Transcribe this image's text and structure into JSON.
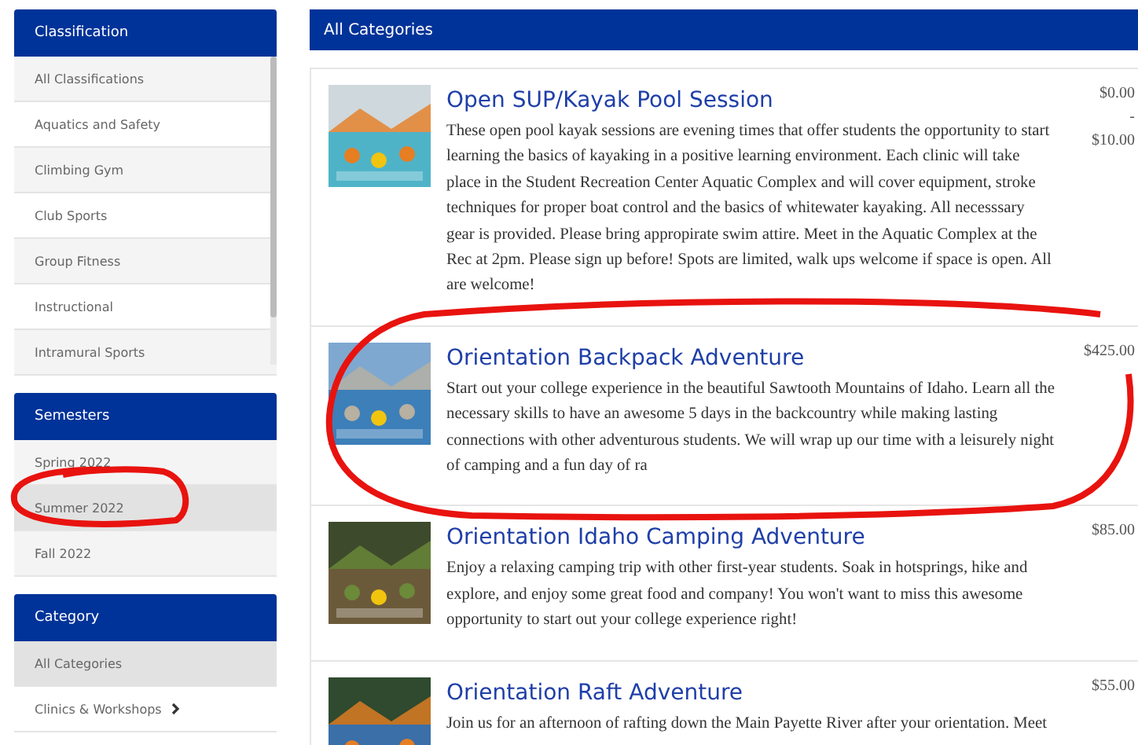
{
  "sidebar": {
    "panels": [
      {
        "title": "Classification",
        "scrollable": true,
        "items": [
          {
            "label": "All Classifications",
            "selected": false
          },
          {
            "label": "Aquatics and Safety",
            "selected": false
          },
          {
            "label": "Climbing Gym",
            "selected": false
          },
          {
            "label": "Club Sports",
            "selected": false
          },
          {
            "label": "Group Fitness",
            "selected": false
          },
          {
            "label": "Instructional",
            "selected": false
          },
          {
            "label": "Intramural Sports",
            "selected": false
          }
        ]
      },
      {
        "title": "Semesters",
        "scrollable": false,
        "items": [
          {
            "label": "Spring 2022",
            "selected": false
          },
          {
            "label": "Summer 2022",
            "selected": true
          },
          {
            "label": "Fall 2022",
            "selected": false
          }
        ]
      },
      {
        "title": "Category",
        "scrollable": false,
        "items": [
          {
            "label": "All Categories",
            "selected": true
          },
          {
            "label": "Clinics & Workshops",
            "selected": false,
            "has_submenu": true
          }
        ]
      }
    ]
  },
  "main": {
    "title": "All Categories",
    "programs": [
      {
        "kind": "picture",
        "title": "Open SUP/Kayak Pool Session",
        "description": "These open pool kayak sessions are evening times that offer students the opportunity to start learning the basics of kayaking in a positive learning environment. Each clinic will take place in the Student Recreation Center Aquatic Complex and will cover equipment, stroke techniques for proper boat control and the basics of whitewater kayaking. All necesssary gear is provided. Please bring appropirate swim attire. Meet in the Aquatic Complex at the Rec at 2pm. Please sign up before! Spots are limited, walk ups welcome if space is open. All are welcome!",
        "price": [
          "$0.00",
          "-",
          "$10.00"
        ]
      },
      {
        "kind": "picture",
        "title": "Orientation Backpack Adventure",
        "description": "Start out your college experience in the beautiful Sawtooth Mountains of Idaho. Learn all the necessary skills to have an awesome 5 days in the backcountry while making lasting connections with other adventurous students. We will wrap up our time with a leisurely night of camping and a fun day of ra",
        "price": [
          "$425.00"
        ]
      },
      {
        "kind": "picture",
        "title": "Orientation Idaho Camping Adventure",
        "description": "Enjoy a relaxing camping trip with other first-year students. Soak in hotsprings, hike and explore, and enjoy some great food and company! You won't want to miss this awesome opportunity to start out your college experience right!",
        "price": [
          "$85.00"
        ]
      },
      {
        "kind": "picture",
        "title": "Orientation Raft Adventure",
        "description": "Join us for an afternoon of rafting down the Main Payette River after your orientation. Meet",
        "price": [
          "$55.00"
        ]
      }
    ]
  }
}
